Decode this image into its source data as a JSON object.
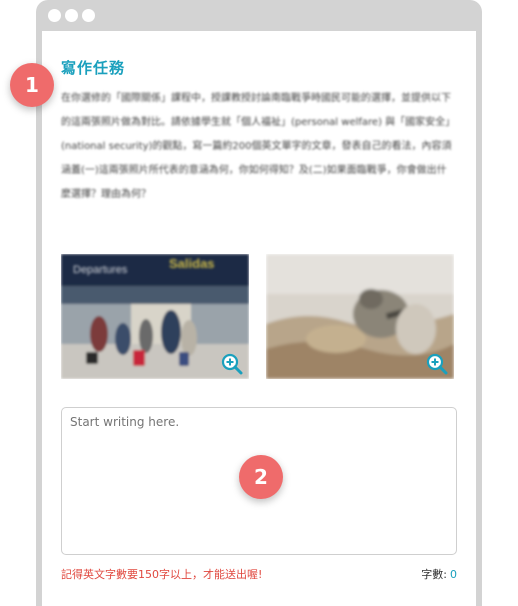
{
  "task": {
    "title": "寫作任務",
    "body": "在你選修的「國際關係」課程中，授課教授討論南臨戰爭時國民可能的選擇，並提供以下的這兩張照片做為對比。請依據學生就「個人福祉」(personal welfare) 與「國家安全」(national security)的觀點，寫一篇約200個英文單字的文章，發表自己的看法，內容須涵蓋(一)這兩張照片所代表的意涵為何，你如何得知？及(二)如果面臨戰爭，你會做出什麼選擇？理由為何？"
  },
  "markers": {
    "task_marker": "1",
    "writing_marker": "2"
  },
  "photos": [
    {
      "icon": "zoom-in-icon",
      "sign_left": "Departures",
      "sign_right": "Salidas"
    },
    {
      "icon": "zoom-in-icon"
    }
  ],
  "writing": {
    "placeholder": "Start writing here.",
    "value": ""
  },
  "footer": {
    "hint": "記得英文字數要150字以上，才能送出喔!",
    "count_label": "字數:",
    "count_value": "0"
  },
  "colors": {
    "accent": "#1aa0bd",
    "marker": "#ef6b6b",
    "warning": "#e0483f",
    "frame": "#d3d3d3"
  }
}
